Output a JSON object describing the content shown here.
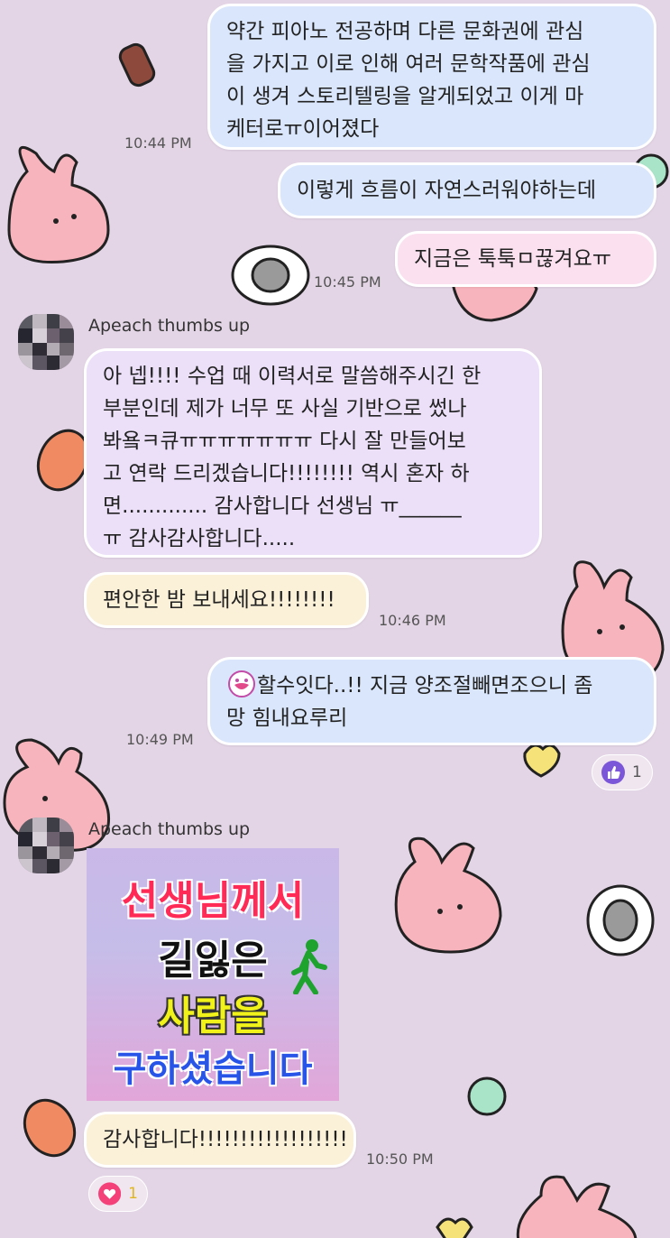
{
  "colors": {
    "background": "#e4d5e6",
    "bubble_sent": "#d9e6fb",
    "bubble_pink": "#fbe0ef",
    "bubble_received": "#ece0f9",
    "bubble_cream": "#fbf0d8"
  },
  "messages": [
    {
      "lines": [
        "약간 피아노 전공하며 다른 문화권에 관심",
        "을 가지고 이로 인해 여러 문학작품에 관심",
        "이 생겨 스토리텔링을 알게되었고 이게 마",
        "케터로ㅠ이어졌다"
      ],
      "time": "10:44 PM"
    },
    {
      "lines": [
        "이렇게 흐름이 자연스러워야하는데"
      ]
    },
    {
      "lines": [
        "지금은 툭툭ㅁ끊겨요ㅠ"
      ],
      "time": "10:45 PM"
    },
    {
      "sender": "Apeach thumbs up",
      "lines": [
        "아 넵!!!! 수업 때 이력서로 말씀해주시긴 한",
        "부분인데 제가 너무 또 사실 기반으로 썼나",
        "봐욬ㅋ큐ㅠㅠㅠㅠㅠㅠㅠ 다시 잘 만들어보",
        "고 연락 드리겠습니다!!!!!!!! 역시 혼자 하",
        "면............. 감사합니다 선생님 ㅠ______",
        "ㅠ 감사감사합니다....."
      ]
    },
    {
      "lines": [
        "편안한 밤 보내세요!!!!!!!!"
      ],
      "time": "10:46 PM"
    },
    {
      "lines": [
        "할수잇다..!! 지금 양조절빼면조으니 좀",
        "망 힘내요루리"
      ],
      "time": "10:49 PM",
      "reaction": {
        "icon": "thumbs-up-icon",
        "count": "1"
      }
    },
    {
      "sender": "Apeach thumbs up",
      "sticker": {
        "line1": "선생님께서",
        "line2": "길잃은",
        "line3": "사람을",
        "line4": "구하셨습니다"
      }
    },
    {
      "lines": [
        "감사합니다!!!!!!!!!!!!!!!!!!"
      ],
      "time": "10:50 PM",
      "reaction": {
        "icon": "heart-icon",
        "count": "1"
      }
    }
  ]
}
